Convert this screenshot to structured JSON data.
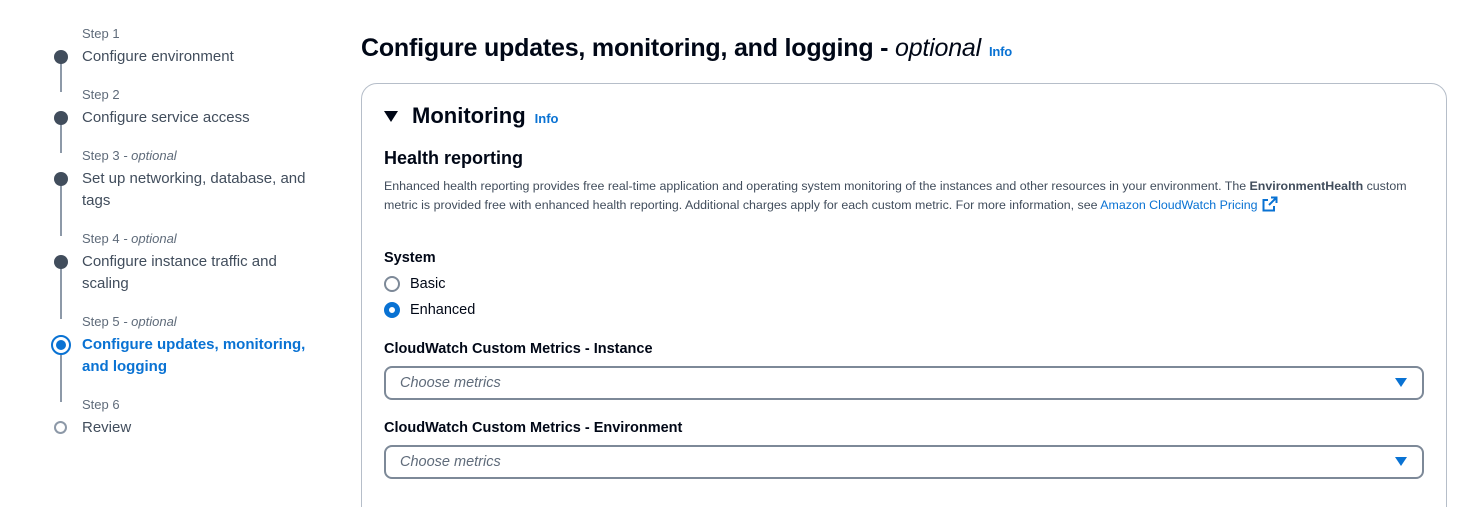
{
  "steps": [
    {
      "caption": "Step 1",
      "optional": "",
      "title": "Configure environment",
      "state": "done"
    },
    {
      "caption": "Step 2",
      "optional": "",
      "title": "Configure service access",
      "state": "done"
    },
    {
      "caption": "Step 3",
      "optional": " - optional",
      "title": "Set up networking, database, and tags",
      "state": "done"
    },
    {
      "caption": "Step 4",
      "optional": " - optional",
      "title": "Configure instance traffic and scaling",
      "state": "done"
    },
    {
      "caption": "Step 5",
      "optional": " - optional",
      "title": "Configure updates, monitoring, and logging",
      "state": "current"
    },
    {
      "caption": "Step 6",
      "optional": "",
      "title": "Review",
      "state": "pending"
    }
  ],
  "page": {
    "title": "Configure updates, monitoring, and logging - ",
    "title_optional": "optional",
    "info": "Info"
  },
  "monitoring": {
    "title": "Monitoring",
    "info": "Info",
    "health_reporting": {
      "title": "Health reporting",
      "desc_part1": "Enhanced health reporting provides free real-time application and operating system monitoring of the instances and other resources in your environment. The ",
      "desc_bold": "EnvironmentHealth",
      "desc_part2": " custom metric is provided free with enhanced health reporting. Additional charges apply for each custom metric. For more information, see ",
      "desc_link": "Amazon CloudWatch Pricing",
      "link_icon": "external-link-icon"
    },
    "system": {
      "label": "System",
      "options": [
        {
          "label": "Basic",
          "checked": false
        },
        {
          "label": "Enhanced",
          "checked": true
        }
      ]
    },
    "instance_metrics": {
      "label": "CloudWatch Custom Metrics - Instance",
      "placeholder": "Choose metrics"
    },
    "environment_metrics": {
      "label": "CloudWatch Custom Metrics - Environment",
      "placeholder": "Choose metrics"
    }
  },
  "colors": {
    "accent": "#0972d3",
    "text": "#000716",
    "muted": "#5f6b7a",
    "border": "#7d8998"
  }
}
